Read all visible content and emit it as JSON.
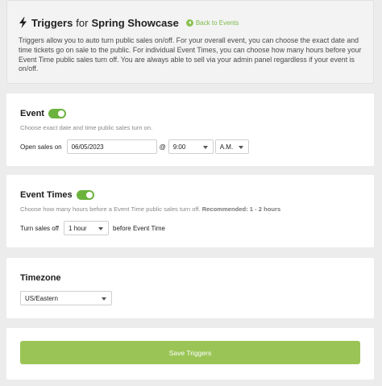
{
  "header": {
    "title_prefix": "Triggers",
    "title_for": "for",
    "event_name": "Spring Showcase",
    "back_link": "Back to Events",
    "description": "Triggers allow you to auto turn public sales on/off. For your overall event, you can choose the exact date and time tickets go on sale to the public. For individual Event Times, you can choose how many hours before your Event Time public sales turn off. You are always able to sell via your admin panel regardless if your event is on/off."
  },
  "event": {
    "title": "Event",
    "toggle_on": true,
    "hint": "Choose exact date and time public sales turn on.",
    "open_label": "Open sales on",
    "date_value": "06/05/2023",
    "at": "@",
    "time_value": "9:00",
    "ampm_value": "A.M."
  },
  "event_times": {
    "title": "Event Times",
    "toggle_on": true,
    "hint": "Choose how many hours before a Event Time public sales turn off.",
    "hint_rec": "Recommended: 1 - 2 hours",
    "turn_off_label": "Turn sales off",
    "hours_value": "1 hour",
    "before_label": "before Event Time"
  },
  "timezone": {
    "title": "Timezone",
    "value": "US/Eastern"
  },
  "save": {
    "label": "Save Triggers"
  },
  "colors": {
    "accent_green": "#6cb33e",
    "button_green": "#9ac556",
    "link_green": "#7cbb4b"
  },
  "icons": {
    "title": "bolt-icon",
    "back": "circle-arrow-left-icon"
  }
}
